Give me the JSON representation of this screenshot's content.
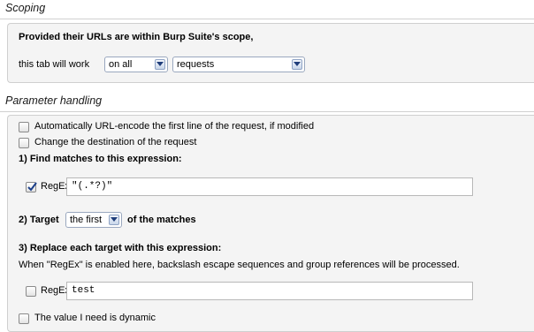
{
  "scoping": {
    "title": "Scoping",
    "heading": "Provided their URLs are within Burp Suite's scope,",
    "prefix": "this tab will work",
    "scope_select": "on all",
    "type_select": "requests"
  },
  "param": {
    "title": "Parameter handling",
    "url_encode": {
      "label": "Automatically URL-encode the first line of the request, if modified",
      "checked": false
    },
    "change_dest": {
      "label": "Change the destination of the request",
      "checked": false
    },
    "find_heading": "1) Find matches to this expression:",
    "find_regex": {
      "label": "RegEx",
      "checked": true,
      "value": "\"(.*?)\""
    },
    "target_prefix": "2) Target",
    "target_select": "the first",
    "target_suffix": "of the matches",
    "replace_heading": "3) Replace each target with this expression:",
    "note": "When \"RegEx\" is enabled here, backslash escape sequences and group references will be processed.",
    "replace_regex": {
      "label": "RegEx",
      "checked": false,
      "value": "test"
    },
    "dynamic": {
      "label": "The value I need is dynamic",
      "checked": false
    }
  }
}
